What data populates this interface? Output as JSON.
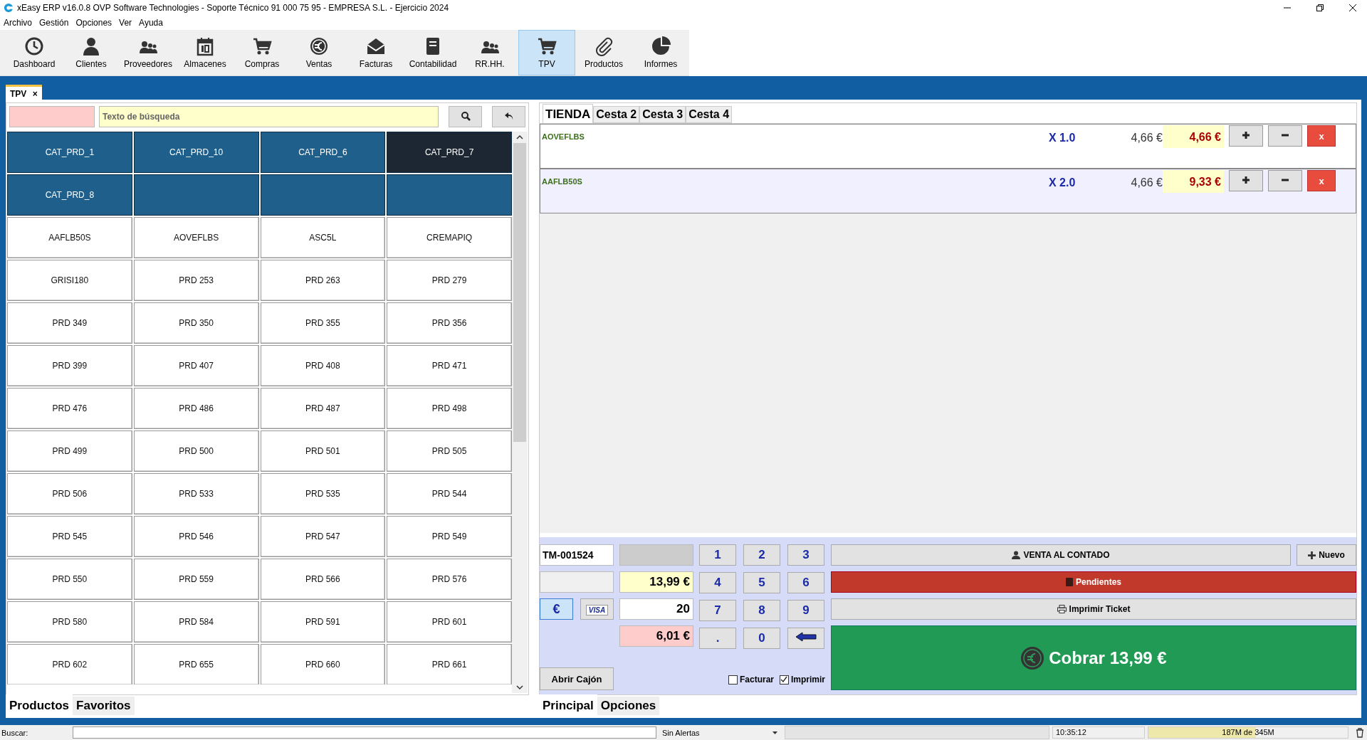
{
  "window": {
    "title": "xEasy ERP v16.0.8 OVP Software Technologies - Soporte Técnico 91 000 75 95 - EMPRESA S.L. - Ejercicio 2024"
  },
  "menu": [
    "Archivo",
    "Gestión",
    "Opciones",
    "Ver",
    "Ayuda"
  ],
  "toolbar": [
    {
      "label": "Dashboard",
      "selected": false
    },
    {
      "label": "Clientes",
      "selected": false
    },
    {
      "label": "Proveedores",
      "selected": false
    },
    {
      "label": "Almacenes",
      "selected": false
    },
    {
      "label": "Compras",
      "selected": false
    },
    {
      "label": "Ventas",
      "selected": false
    },
    {
      "label": "Facturas",
      "selected": false
    },
    {
      "label": "Contabilidad",
      "selected": false
    },
    {
      "label": "RR.HH.",
      "selected": false
    },
    {
      "label": "TPV",
      "selected": true
    },
    {
      "label": "Productos",
      "selected": false
    },
    {
      "label": "Informes",
      "selected": false
    }
  ],
  "doc_tabs": [
    {
      "label": "TPV",
      "close": "×",
      "selected": true
    }
  ],
  "search": {
    "placeholder": "Texto de búsqueda"
  },
  "categories": [
    {
      "label": "CAT_PRD_1",
      "selected": false
    },
    {
      "label": "CAT_PRD_10",
      "selected": false
    },
    {
      "label": "CAT_PRD_6",
      "selected": false
    },
    {
      "label": "CAT_PRD_7",
      "selected": true
    },
    {
      "label": "CAT_PRD_8",
      "selected": false
    }
  ],
  "products": [
    "AAFLB50S",
    "AOVEFLBS",
    "ASC5L",
    "CREMAPIQ",
    "GRISI180",
    "PRD 253",
    "PRD 263",
    "PRD 279",
    "PRD 349",
    "PRD 350",
    "PRD 355",
    "PRD 356",
    "PRD 399",
    "PRD 407",
    "PRD 408",
    "PRD 471",
    "PRD 476",
    "PRD 486",
    "PRD 487",
    "PRD 498",
    "PRD 499",
    "PRD 500",
    "PRD 501",
    "PRD 505",
    "PRD 506",
    "PRD 533",
    "PRD 535",
    "PRD 544",
    "PRD 545",
    "PRD 546",
    "PRD 547",
    "PRD 549",
    "PRD 550",
    "PRD 559",
    "PRD 566",
    "PRD 576",
    "PRD 580",
    "PRD 584",
    "PRD 591",
    "PRD 601",
    "PRD 602",
    "PRD 655",
    "PRD 660",
    "PRD 661"
  ],
  "left_tabs": [
    {
      "label": "Productos",
      "selected": true
    },
    {
      "label": "Favoritos",
      "selected": false
    }
  ],
  "basket_tabs": [
    {
      "label": "TIENDA",
      "selected": true
    },
    {
      "label": "Cesta 2",
      "selected": false
    },
    {
      "label": "Cesta 3",
      "selected": false
    },
    {
      "label": "Cesta 4",
      "selected": false
    }
  ],
  "lines": [
    {
      "name": "AOVEFLBS",
      "qty": "X 1.0",
      "price": "4,66 €",
      "total": "4,66 €",
      "remove": "x",
      "selected": false
    },
    {
      "name": "AAFLB50S",
      "qty": "X 2.0",
      "price": "4,66 €",
      "total": "9,33 €",
      "remove": "x",
      "selected": true
    }
  ],
  "ticket": {
    "number": "TM-001524",
    "total": "13,99 €",
    "paid": "20",
    "change": "6,01 €",
    "cash": {
      "label": "€",
      "selected": true
    },
    "card": {
      "label": "VISA",
      "selected": false
    }
  },
  "keypad": [
    "1",
    "2",
    "3",
    "4",
    "5",
    "6",
    "7",
    "8",
    "9",
    ".",
    "0"
  ],
  "open_drawer": "Abrir Cajón",
  "options": [
    {
      "label": "Facturar",
      "checked": false
    },
    {
      "label": "Imprimir",
      "checked": true
    }
  ],
  "customer": "VENTA AL CONTADO",
  "new": "Nuevo",
  "pending": "Pendientes",
  "print": "Imprimir Ticket",
  "charge": "Cobrar 13,99 €",
  "right_tabs": [
    {
      "label": "Principal",
      "selected": true
    },
    {
      "label": "Opciones",
      "selected": false
    }
  ],
  "status_bar": {
    "search_label": "Buscar:",
    "alerts": "Sin Alertas",
    "time": "10:35:12",
    "memory": {
      "text": "187M de 345M",
      "level": 0.54
    }
  }
}
